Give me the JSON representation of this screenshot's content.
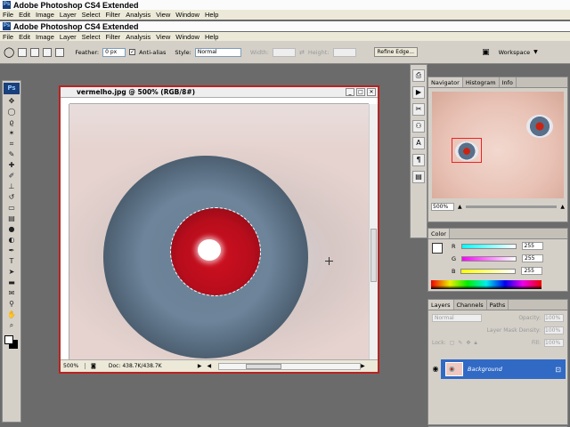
{
  "windows": [
    {
      "title": "Adobe Photoshop CS4 Extended",
      "menu": [
        "File",
        "Edit",
        "Image",
        "Layer",
        "Select",
        "Filter",
        "Analysis",
        "View",
        "Window",
        "Help"
      ]
    },
    {
      "title": "Adobe Photoshop CS4 Extended",
      "menu": [
        "File",
        "Edit",
        "Image",
        "Layer",
        "Select",
        "Filter",
        "Analysis",
        "View",
        "Window",
        "Help"
      ]
    }
  ],
  "colors": {
    "title_bg": "#fbfbfb",
    "accent_red": "#b22222",
    "selected_layer": "#316ac5",
    "panel_bg": "#d4d0c8",
    "workspace_bg": "#6b6b6b"
  },
  "options": {
    "feather_label": "Feather:",
    "feather_value": "0 px",
    "antialias_label": "Anti-alias",
    "antialias_checked": true,
    "style_label": "Style:",
    "style_value": "Normal",
    "width_label": "Width:",
    "height_label": "Height:",
    "refine_edge": "Refine Edge...",
    "workspace": "Workspace"
  },
  "toolbox": {
    "logo": "Ps",
    "tools": [
      {
        "name": "move-icon",
        "glyph": "✥"
      },
      {
        "name": "ellipse-marquee-icon",
        "glyph": "◯"
      },
      {
        "name": "lasso-icon",
        "glyph": "ϱ"
      },
      {
        "name": "magic-wand-icon",
        "glyph": "✶"
      },
      {
        "name": "crop-icon",
        "glyph": "⌗"
      },
      {
        "name": "eyedropper-icon",
        "glyph": "✎"
      },
      {
        "name": "healing-brush-icon",
        "glyph": "✚"
      },
      {
        "name": "brush-icon",
        "glyph": "✐"
      },
      {
        "name": "clone-stamp-icon",
        "glyph": "⊥"
      },
      {
        "name": "history-brush-icon",
        "glyph": "↺"
      },
      {
        "name": "eraser-icon",
        "glyph": "▭"
      },
      {
        "name": "gradient-icon",
        "glyph": "▤"
      },
      {
        "name": "blur-icon",
        "glyph": "●"
      },
      {
        "name": "dodge-icon",
        "glyph": "◐"
      },
      {
        "name": "pen-icon",
        "glyph": "✒"
      },
      {
        "name": "type-icon",
        "glyph": "T"
      },
      {
        "name": "path-selection-icon",
        "glyph": "➤"
      },
      {
        "name": "shape-icon",
        "glyph": "▬"
      },
      {
        "name": "notes-icon",
        "glyph": "✉"
      },
      {
        "name": "eyedropper2-icon",
        "glyph": "⚲"
      },
      {
        "name": "hand-icon",
        "glyph": "✋"
      },
      {
        "name": "zoom-icon",
        "glyph": "⌕"
      }
    ]
  },
  "document": {
    "title": "vermelho.jpg @ 500% (RGB/8#)",
    "zoom": "500%",
    "doc_size": "Doc: 438.7K/438.7K"
  },
  "navigator": {
    "tabs": [
      "Navigator",
      "Histogram",
      "Info"
    ],
    "zoom": "500%"
  },
  "color_panel": {
    "tab": "Color",
    "channels": [
      {
        "label": "R",
        "value": "255"
      },
      {
        "label": "G",
        "value": "255"
      },
      {
        "label": "B",
        "value": "255"
      }
    ]
  },
  "layers_panel": {
    "tabs": [
      "Layers",
      "Channels",
      "Paths"
    ],
    "blend_mode": "Normal",
    "opacity_label": "Opacity:",
    "opacity_value": "100%",
    "mask_density_label": "Layer Mask Density:",
    "mask_density_value": "100%",
    "lock_label": "Lock:",
    "fill_label": "Fill:",
    "fill_value": "100%",
    "layer_name": "Background"
  }
}
